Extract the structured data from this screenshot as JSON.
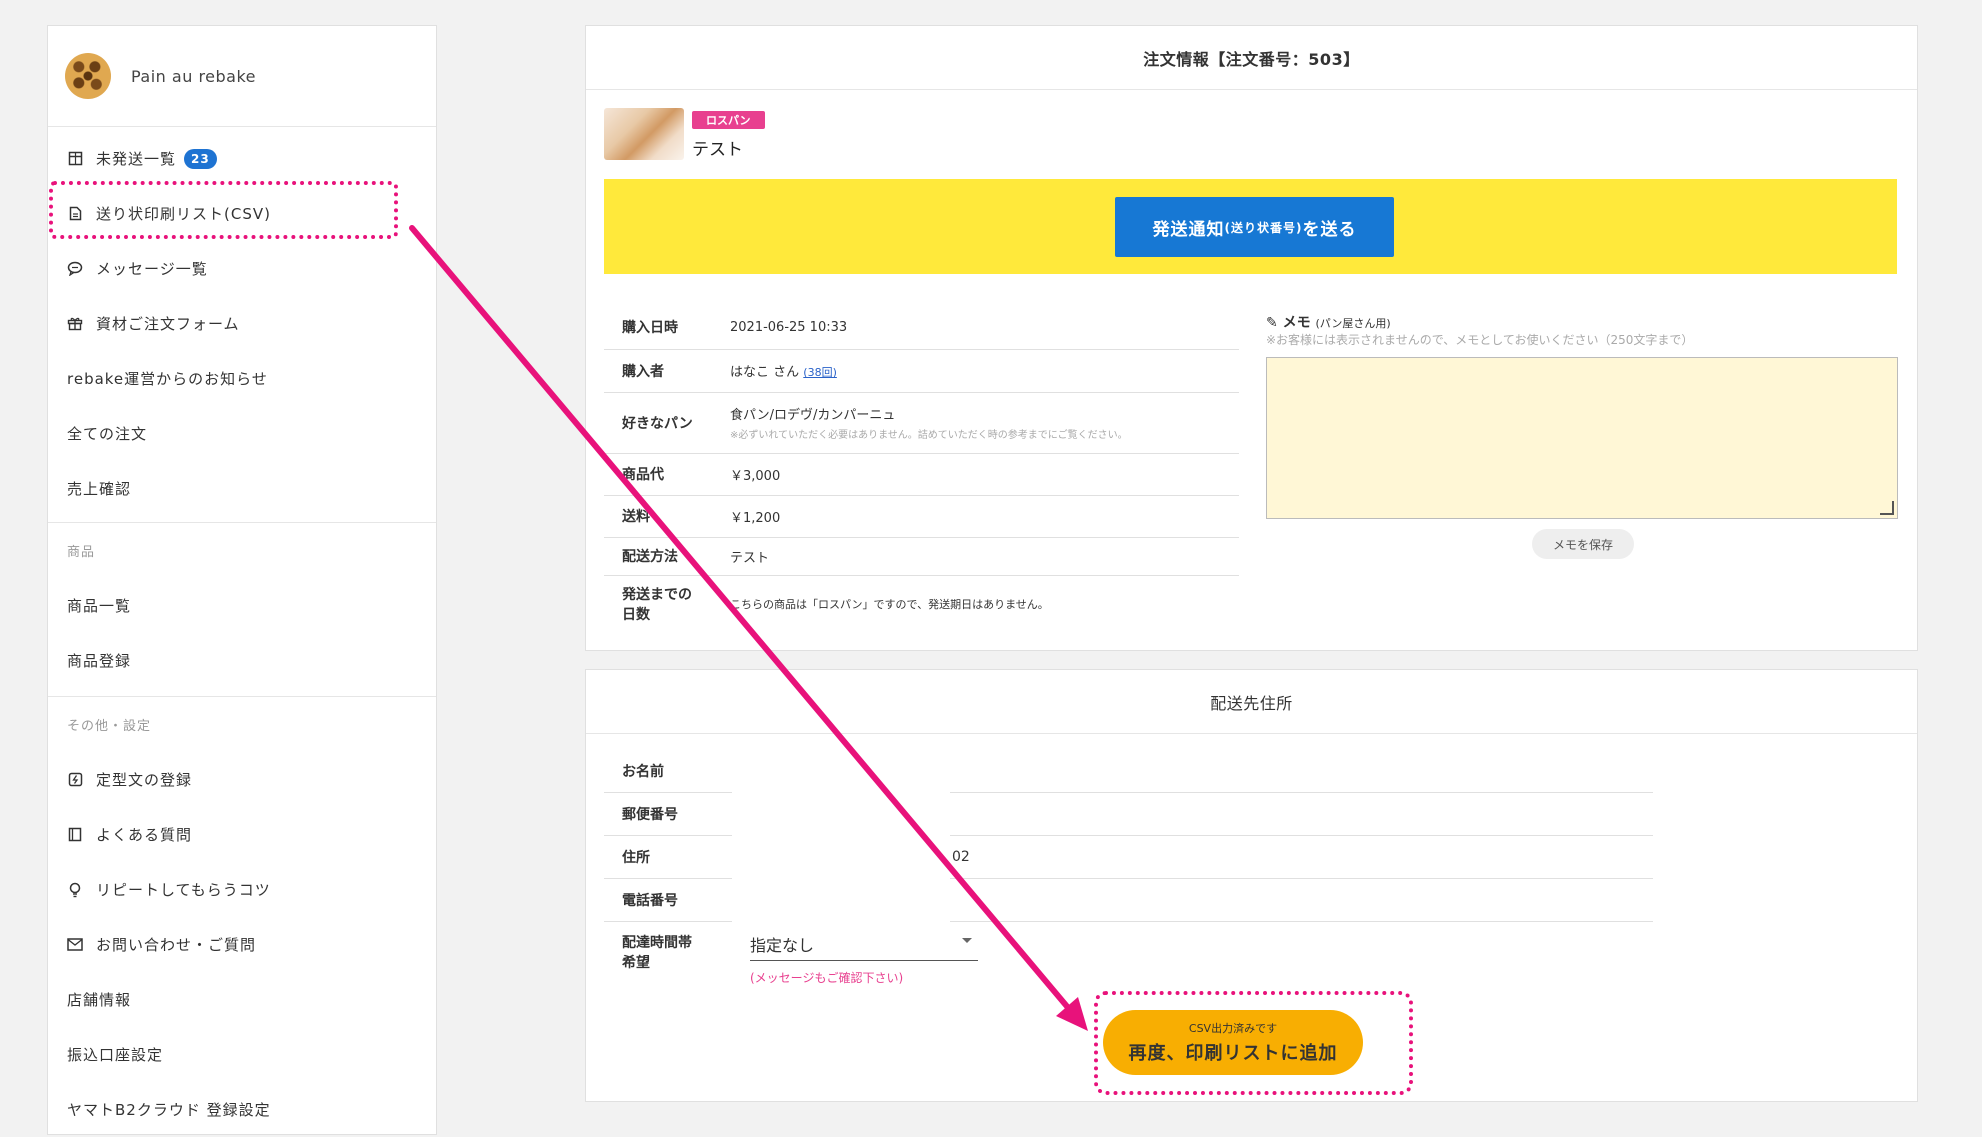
{
  "sidebar": {
    "brand": "Pain au rebake",
    "unshipped_label": "未発送一覧",
    "unshipped_count": "23",
    "items_top": [
      {
        "label": "送り状印刷リスト(CSV)",
        "icon": "document-icon"
      },
      {
        "label": "メッセージ一覧",
        "icon": "chat-icon"
      },
      {
        "label": "資材ご注文フォーム",
        "icon": "gift-icon"
      },
      {
        "label": "rebake運営からのお知らせ",
        "icon": ""
      },
      {
        "label": "全ての注文",
        "icon": ""
      },
      {
        "label": "売上確認",
        "icon": ""
      }
    ],
    "section_products": "商品",
    "items_products": [
      {
        "label": "商品一覧"
      },
      {
        "label": "商品登録"
      }
    ],
    "section_other": "その他・設定",
    "items_other": [
      {
        "label": "定型文の登録",
        "icon": "template-icon"
      },
      {
        "label": "よくある質問",
        "icon": "book-icon"
      },
      {
        "label": "リピートしてもらうコツ",
        "icon": "bulb-icon"
      },
      {
        "label": "お問い合わせ・ご質問",
        "icon": "mail-icon"
      },
      {
        "label": "店舗情報",
        "icon": ""
      },
      {
        "label": "振込口座設定",
        "icon": ""
      },
      {
        "label": "ヤマトB2クラウド 登録設定",
        "icon": ""
      }
    ]
  },
  "order": {
    "header": "注文情報【注文番号：503】",
    "product_tag": "ロスパン",
    "product_name": "テスト",
    "notify_button_main": "発送通知",
    "notify_button_sub": "(送り状番号)",
    "notify_button_end": "を送る",
    "rows": {
      "purchase_date_label": "購入日時",
      "purchase_date": "2021-06-25 10:33",
      "buyer_label": "購入者",
      "buyer": "はなこ さん",
      "buyer_link": "(38回)",
      "fav_label": "好きなパン",
      "fav": "食パン/ロデヴ/カンパーニュ",
      "fav_note": "※必ずいれていただく必要はありません。詰めていただく時の参考までにご覧ください。",
      "price_label": "商品代",
      "price": "￥3,000",
      "shipping_label": "送料",
      "shipping": "￥1,200",
      "method_label": "配送方法",
      "method": "テスト",
      "days_label_1": "発送までの",
      "days_label_2": "日数",
      "days": "こちらの商品は「ロスパン」ですので、発送期日はありません。"
    },
    "memo_title": "メモ",
    "memo_title_sub": "(パン屋さん用)",
    "memo_hint": "※お客様には表示されませんので、メモとしてお使いください（250文字まで）",
    "memo_save": "メモを保存"
  },
  "shipping": {
    "header": "配送先住所",
    "name_label": "お名前",
    "zip_label": "郵便番号",
    "address_label": "住所",
    "address_value": "02",
    "phone_label": "電話番号",
    "time_label_1": "配達時間帯",
    "time_label_2": "希望",
    "time_value": "指定なし",
    "time_note": "(メッセージもご確認下さい)",
    "csv_small": "CSV出力済みです",
    "csv_big": "再度、印刷リストに追加"
  },
  "colors": {
    "accent_blue": "#1778d4",
    "yellow_bar": "#ffe93b",
    "orange_button": "#f8ae02",
    "annotation_pink": "#e8127b"
  }
}
